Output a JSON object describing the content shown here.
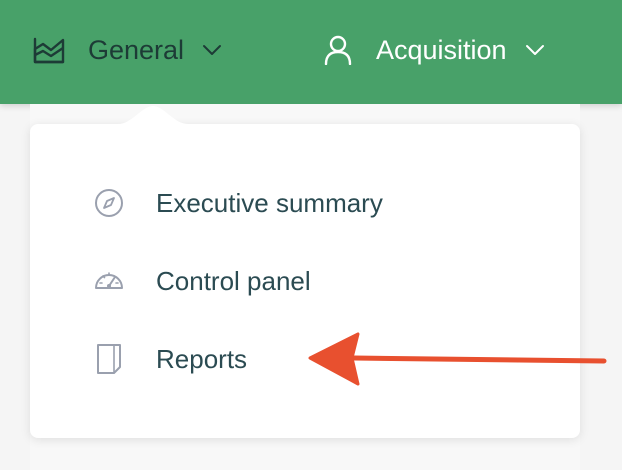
{
  "navbar": {
    "items": [
      {
        "label": "General",
        "icon": "area-chart-icon",
        "active": true
      },
      {
        "label": "Acquisition",
        "icon": "user-icon",
        "active": false
      }
    ],
    "background_color": "#48a169"
  },
  "dropdown": {
    "items": [
      {
        "label": "Executive summary",
        "icon": "compass-icon"
      },
      {
        "label": "Control panel",
        "icon": "speedometer-icon"
      },
      {
        "label": "Reports",
        "icon": "document-icon"
      }
    ]
  },
  "annotation": {
    "arrow_color": "#e8502f",
    "points_to": "Reports"
  }
}
